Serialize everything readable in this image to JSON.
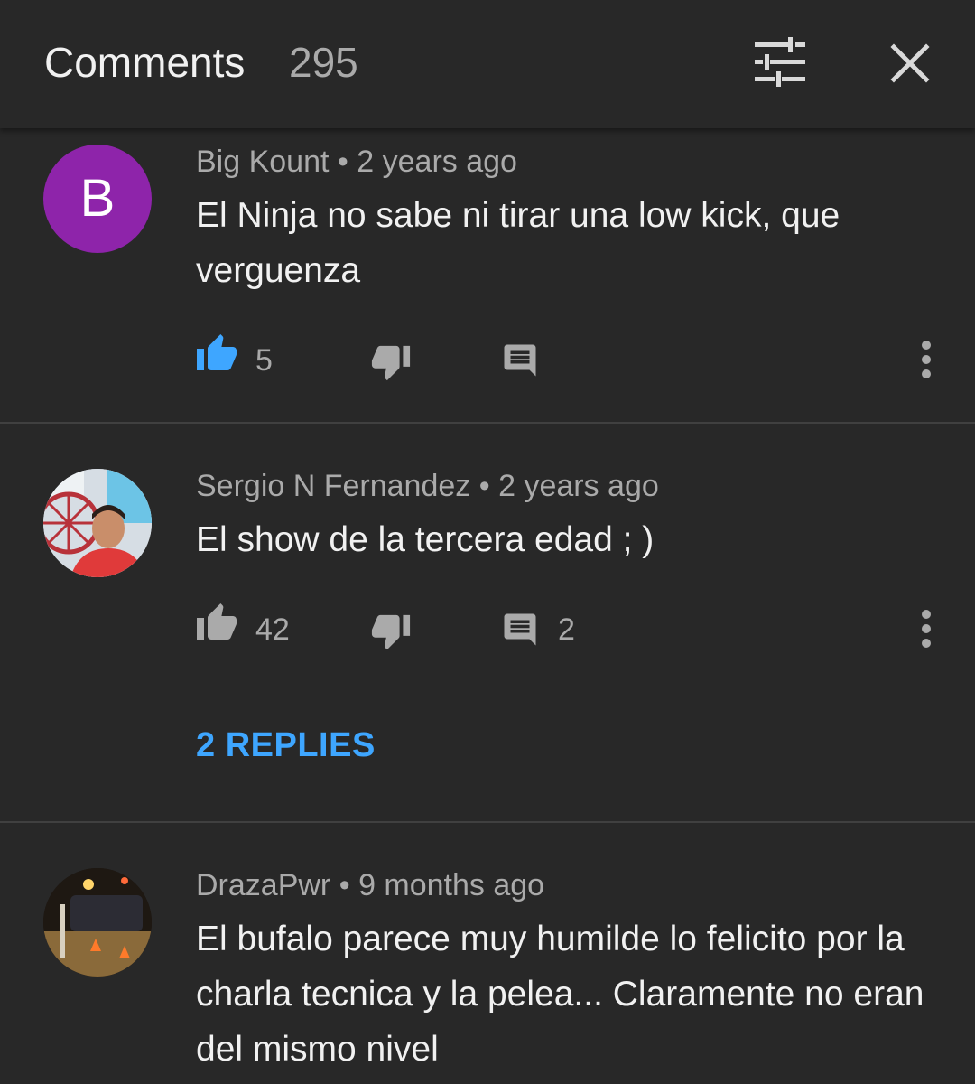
{
  "header": {
    "title": "Comments",
    "count": "295"
  },
  "colors": {
    "background": "#282828",
    "accent": "#3ea6ff",
    "muted": "#aaaaaa",
    "text": "#f1f1f1",
    "avatar_b": "#8e24aa"
  },
  "comments": [
    {
      "avatar_letter": "B",
      "author": "Big Kount",
      "time": "2 years ago",
      "text": "El Ninja no sabe ni tirar una low kick, que verguenza",
      "likes": "5",
      "liked": true,
      "replies_count": ""
    },
    {
      "author": "Sergio N Fernandez",
      "time": "2 years ago",
      "text": "El show de la tercera edad ; )",
      "likes": "42",
      "liked": false,
      "replies_count": "2",
      "replies_label": "2 REPLIES"
    },
    {
      "author": "DrazaPwr",
      "time": "9 months ago",
      "text": "El bufalo parece muy humilde lo felicito por la charla tecnica y la pelea... Claramente no eran del mismo nivel"
    }
  ],
  "meta_separator": "•",
  "icons": [
    "sort-filter-icon",
    "close-icon",
    "thumbs-up-icon",
    "thumbs-down-icon",
    "reply-comment-icon",
    "more-vert-icon"
  ]
}
